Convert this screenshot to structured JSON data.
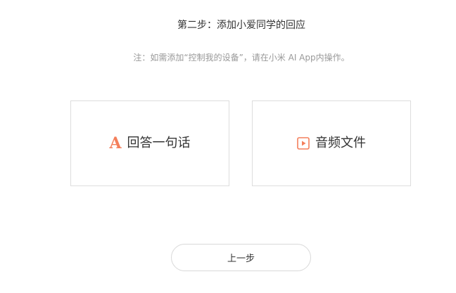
{
  "header": {
    "step_title": "第二步：添加小爱同学的回应",
    "note": "注：如需添加“控制我的设备”，请在小米 AI App内操作。"
  },
  "options": [
    {
      "label": "回答一句话",
      "icon": "letter-a-icon",
      "icon_glyph": "A"
    },
    {
      "label": "音频文件",
      "icon": "play-file-icon"
    }
  ],
  "footer": {
    "prev_label": "上一步"
  },
  "colors": {
    "accent": "#f47f5b",
    "border": "#dddddd",
    "muted_text": "#999999",
    "text": "#333333"
  }
}
